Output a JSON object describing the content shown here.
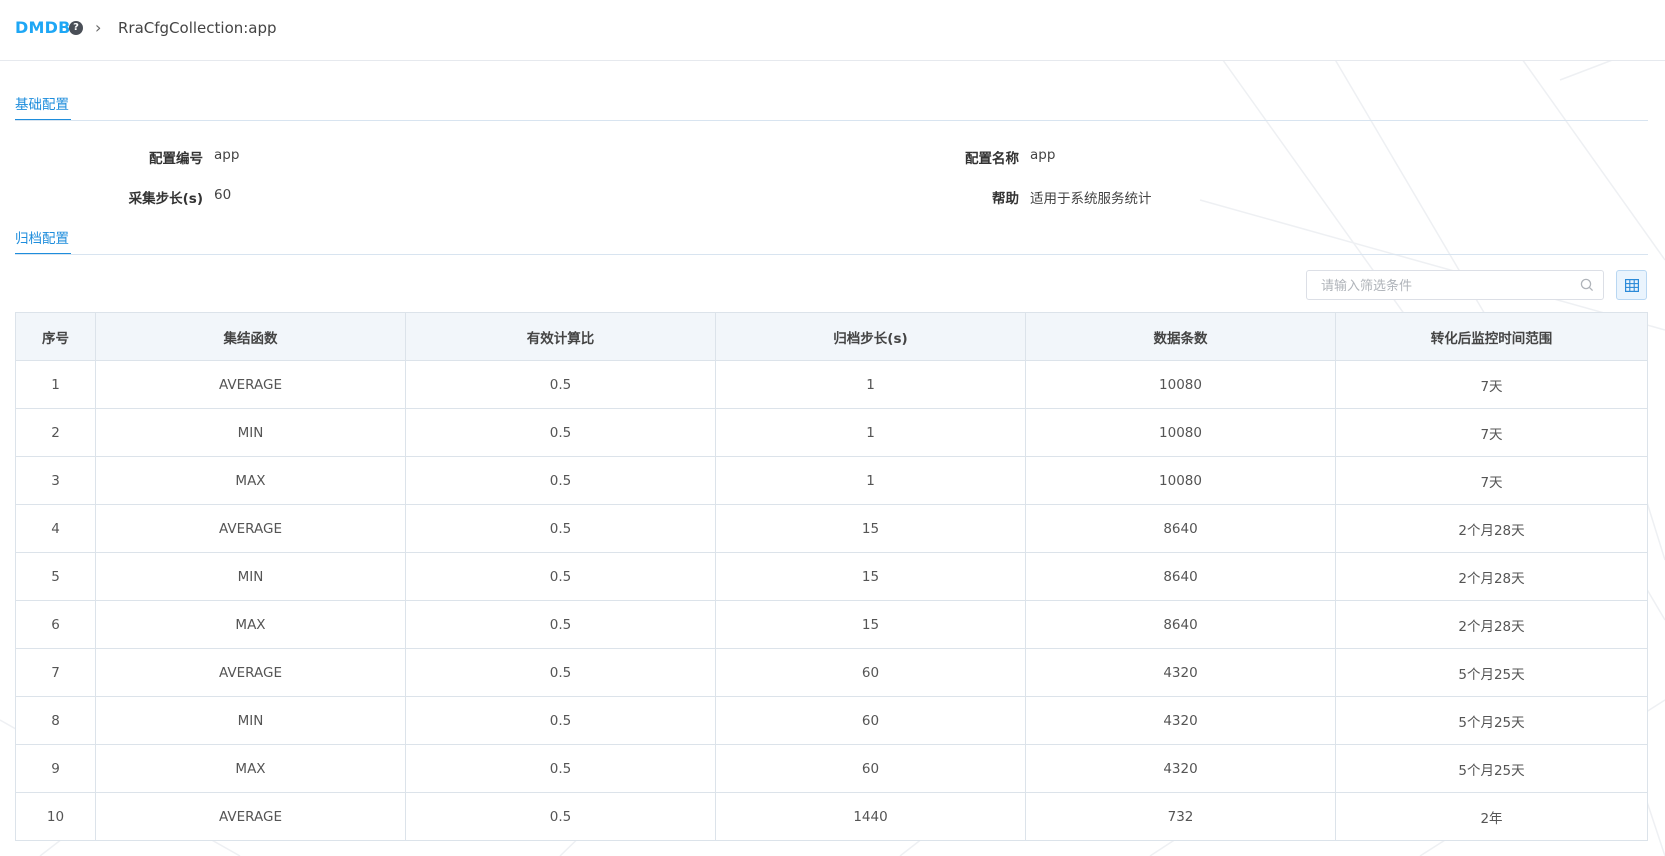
{
  "header": {
    "brand": "DMDB",
    "help_glyph": "?",
    "separator": "›",
    "title": "RraCfgCollection:app"
  },
  "sections": {
    "basic": "基础配置",
    "archive": "归档配置"
  },
  "form": {
    "config_id_label": "配置编号",
    "config_id_value": "app",
    "config_name_label": "配置名称",
    "config_name_value": "app",
    "step_label": "采集步长(s)",
    "step_value": "60",
    "help_label": "帮助",
    "help_value": "适用于系统服务统计"
  },
  "toolbar": {
    "search_placeholder": "请输入筛选条件"
  },
  "table": {
    "columns": [
      "序号",
      "集结函数",
      "有效计算比",
      "归档步长(s)",
      "数据条数",
      "转化后监控时间范围"
    ],
    "rows": [
      [
        "1",
        "AVERAGE",
        "0.5",
        "1",
        "10080",
        "7天"
      ],
      [
        "2",
        "MIN",
        "0.5",
        "1",
        "10080",
        "7天"
      ],
      [
        "3",
        "MAX",
        "0.5",
        "1",
        "10080",
        "7天"
      ],
      [
        "4",
        "AVERAGE",
        "0.5",
        "15",
        "8640",
        "2个月28天"
      ],
      [
        "5",
        "MIN",
        "0.5",
        "15",
        "8640",
        "2个月28天"
      ],
      [
        "6",
        "MAX",
        "0.5",
        "15",
        "8640",
        "2个月28天"
      ],
      [
        "7",
        "AVERAGE",
        "0.5",
        "60",
        "4320",
        "5个月25天"
      ],
      [
        "8",
        "MIN",
        "0.5",
        "60",
        "4320",
        "5个月25天"
      ],
      [
        "9",
        "MAX",
        "0.5",
        "60",
        "4320",
        "5个月25天"
      ],
      [
        "10",
        "AVERAGE",
        "0.5",
        "1440",
        "732",
        "2年"
      ]
    ]
  },
  "colors": {
    "brand": "#1ea7f5",
    "accent": "#1e8ddc",
    "header_bg": "#f2f6fa",
    "border": "#dce3ea"
  }
}
